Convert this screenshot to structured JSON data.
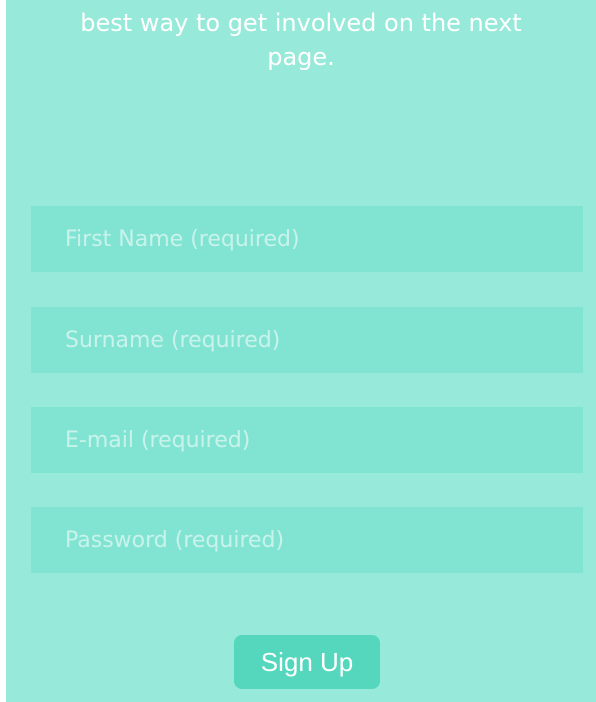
{
  "intro": {
    "text": "best way to get involved on the next\npage."
  },
  "form": {
    "fields": [
      {
        "placeholder": "First Name (required)",
        "value": ""
      },
      {
        "placeholder": "Surname (required)",
        "value": ""
      },
      {
        "placeholder": "E-mail (required)",
        "value": ""
      },
      {
        "placeholder": "Password (required)",
        "value": ""
      }
    ],
    "submit_label": "Sign Up"
  },
  "colors": {
    "background": "#97e9d9",
    "field_background": "#81e4d3",
    "button_background": "#54d7bd",
    "text": "#ffffff"
  }
}
